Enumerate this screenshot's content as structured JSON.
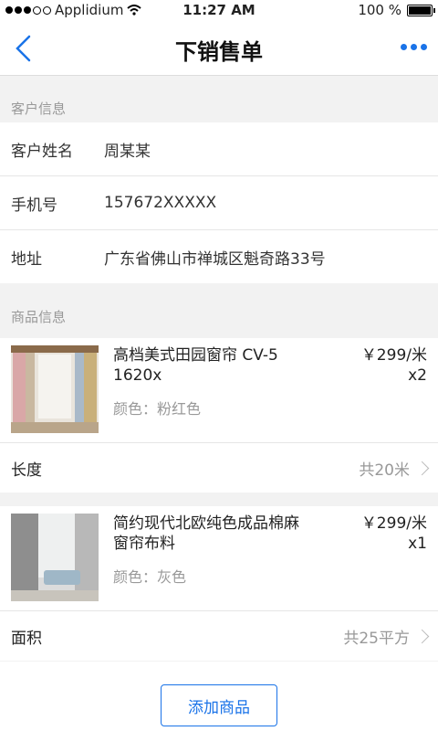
{
  "status_bar": {
    "carrier": "Applidium",
    "time": "11:27 AM",
    "battery": "100 %"
  },
  "nav": {
    "title": "下销售单"
  },
  "customer_section": {
    "label": "客户信息",
    "rows": [
      {
        "label": "客户姓名",
        "value": "周某某"
      },
      {
        "label": "手机号",
        "value": "157672XXXXX"
      },
      {
        "label": "地址",
        "value": "广东省佛山市禅城区魁奇路33号"
      }
    ]
  },
  "product_section": {
    "label": "商品信息",
    "products": [
      {
        "name": "高档美式田园窗帘 CV-5 1620x",
        "color": "颜色：粉红色",
        "price": "￥299/米",
        "qty": "x2",
        "row_label": "长度",
        "row_value": "共20米"
      },
      {
        "name": "简约现代北欧纯色成品棉麻窗帘布料",
        "color": "颜色：灰色",
        "price": "￥299/米",
        "qty": "x1",
        "row_label": "面积",
        "row_value": "共25平方"
      }
    ]
  },
  "add_button": {
    "label": "添加商品"
  },
  "colors": {
    "accent": "#1a73e8",
    "muted": "#999999",
    "background": "#f2f2f2"
  }
}
